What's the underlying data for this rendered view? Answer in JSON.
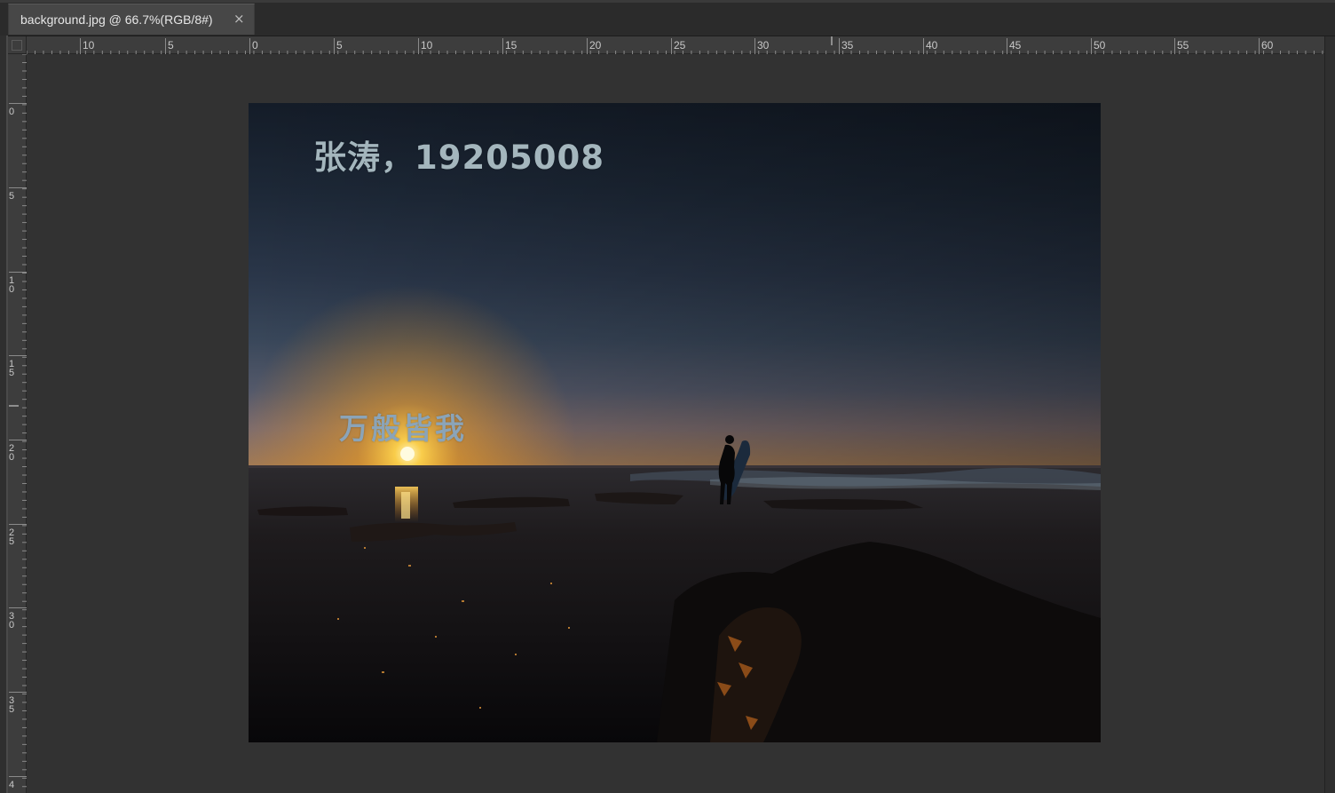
{
  "document_tab": {
    "title": "background.jpg @ 66.7%(RGB/8#)",
    "close_glyph": "×"
  },
  "rulers": {
    "horizontal_labels": [
      "10",
      "5",
      "0",
      "5",
      "10",
      "15",
      "20",
      "25",
      "30",
      "35",
      "40",
      "45",
      "50",
      "55",
      "60"
    ],
    "vertical_labels": [
      [
        "0"
      ],
      [
        "5"
      ],
      [
        "1",
        "0"
      ],
      [
        "1",
        "5"
      ],
      [
        "2",
        "0"
      ],
      [
        "2",
        "5"
      ],
      [
        "3",
        "0"
      ],
      [
        "3",
        "5"
      ],
      [
        "4"
      ]
    ]
  },
  "image": {
    "name_text": "张涛，19205008",
    "motto_text": "万般皆我",
    "name_color": "#a4b6bd",
    "motto_color": "#8ba4b8"
  },
  "icons": {
    "tab_close": "close-icon"
  },
  "colors": {
    "workspace": "#323232",
    "tab_active": "#474747",
    "ruler": "#3d3d3d"
  }
}
